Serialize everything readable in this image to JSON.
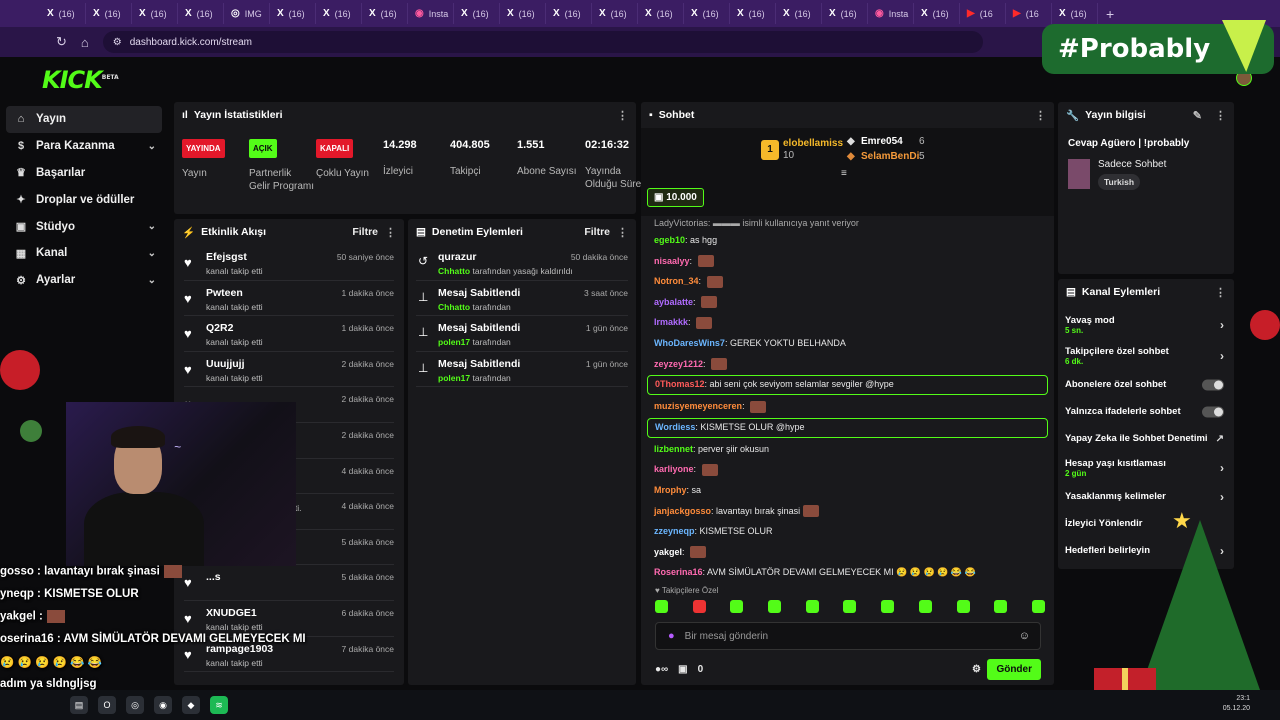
{
  "browser": {
    "tabs": [
      {
        "icon": "X",
        "label": "(16)"
      },
      {
        "icon": "X",
        "label": "(16)"
      },
      {
        "icon": "X",
        "label": "(16)"
      },
      {
        "icon": "X",
        "label": "(16)"
      },
      {
        "icon": "◎",
        "label": "IMG"
      },
      {
        "icon": "X",
        "label": "(16)"
      },
      {
        "icon": "X",
        "label": "(16)"
      },
      {
        "icon": "X",
        "label": "(16)"
      },
      {
        "icon": "◉",
        "label": "Insta"
      },
      {
        "icon": "X",
        "label": "(16)"
      },
      {
        "icon": "X",
        "label": "(16)"
      },
      {
        "icon": "X",
        "label": "(16)"
      },
      {
        "icon": "X",
        "label": "(16)"
      },
      {
        "icon": "X",
        "label": "(16)"
      },
      {
        "icon": "X",
        "label": "(16)"
      },
      {
        "icon": "X",
        "label": "(16)"
      },
      {
        "icon": "X",
        "label": "(16)"
      },
      {
        "icon": "X",
        "label": "(16)"
      },
      {
        "icon": "◉",
        "label": "Insta"
      },
      {
        "icon": "X",
        "label": "(16)"
      },
      {
        "icon": "▶",
        "label": "(16"
      },
      {
        "icon": "▶",
        "label": "(16"
      },
      {
        "icon": "X",
        "label": "(16)"
      }
    ],
    "new_tab": "+",
    "url": "dashboard.kick.com/stream"
  },
  "brand": {
    "logo": "KICK",
    "beta": "BETA",
    "accent": "#53fc18"
  },
  "overlay_banner": "#Probably",
  "sidebar": {
    "items": [
      {
        "icon": "home-icon",
        "label": "Yayın",
        "chevron": false
      },
      {
        "icon": "money-icon",
        "label": "Para Kazanma",
        "chevron": true
      },
      {
        "icon": "trophy-icon",
        "label": "Başarılar",
        "chevron": false
      },
      {
        "icon": "reward-icon",
        "label": "Droplar ve ödüller",
        "chevron": false
      },
      {
        "icon": "studio-icon",
        "label": "Stüdyo",
        "chevron": true
      },
      {
        "icon": "channel-icon",
        "label": "Kanal",
        "chevron": true
      },
      {
        "icon": "settings-icon",
        "label": "Ayarlar",
        "chevron": true
      }
    ]
  },
  "stats": {
    "title": "Yayın İstatistikleri",
    "items": [
      {
        "badge": "YAYINDA",
        "label": "Yayın"
      },
      {
        "badge": "AÇIK",
        "label": "Partnerlik Gelir Programı"
      },
      {
        "badge": "KAPALI",
        "label": "Çoklu Yayın"
      },
      {
        "value": "14.298",
        "label": "İzleyici"
      },
      {
        "value": "404.805",
        "label": "Takipçi"
      },
      {
        "value": "1.551",
        "label": "Abone Sayısı"
      },
      {
        "value": "02:16:32",
        "label": "Yayında Olduğu Süre"
      }
    ]
  },
  "activity": {
    "title": "Etkinlik Akışı",
    "filter": "Filtre",
    "rows": [
      {
        "name": "Efejsgst",
        "sub": "kanalı takip etti",
        "time": "50 saniye önce"
      },
      {
        "name": "Pwteen",
        "sub": "kanalı takip etti",
        "time": "1 dakika önce"
      },
      {
        "name": "Q2R2",
        "sub": "kanalı takip etti",
        "time": "1 dakika önce"
      },
      {
        "name": "Uuujjujj",
        "sub": "kanalı takip etti",
        "time": "2 dakika önce"
      },
      {
        "name": "",
        "sub": "",
        "time": "2 dakika önce"
      },
      {
        "name": "",
        "sub": "",
        "time": "2 dakika önce"
      },
      {
        "name": "",
        "sub": "",
        "time": "4 dakika önce"
      },
      {
        "name": "",
        "sub": "ıcıya abonelik hediye etti.",
        "time": "4 dakika önce"
      },
      {
        "name": "",
        "sub": "",
        "time": "5 dakika önce"
      },
      {
        "name": "...s",
        "sub": "",
        "time": "5 dakika önce"
      },
      {
        "name": "XNUDGE1",
        "sub": "kanalı takip etti",
        "time": "6 dakika önce"
      },
      {
        "name": "rampage1903",
        "sub": "kanalı takip etti",
        "time": "7 dakika önce"
      }
    ]
  },
  "moderation": {
    "title": "Denetim Eylemleri",
    "filter": "Filtre",
    "rows": [
      {
        "icon": "undo-icon",
        "name": "qurazur",
        "actor": "Chhatto",
        "sub": "tarafından yasağı kaldırıldı",
        "time": "50 dakika önce"
      },
      {
        "icon": "pin-icon",
        "name": "Mesaj Sabitlendi",
        "actor": "Chhatto",
        "sub": "tarafından",
        "time": "3 saat önce"
      },
      {
        "icon": "pin-icon",
        "name": "Mesaj Sabitlendi",
        "actor": "polen17",
        "sub": "tarafından",
        "time": "1 gün önce"
      },
      {
        "icon": "pin-icon",
        "name": "Mesaj Sabitlendi",
        "actor": "polen17",
        "sub": "tarafından",
        "time": "1 gün önce"
      }
    ]
  },
  "chat": {
    "title": "Sohbet",
    "leaders": [
      {
        "rank": "1",
        "name": "elobellamiss",
        "count": "10"
      },
      {
        "rank": "2",
        "name": "Emre054",
        "count": "6"
      },
      {
        "rank": "3",
        "name": "SelamBenDi",
        "count": "5"
      }
    ],
    "gift_total": "10.000",
    "reply_hint": "LadyVictorias:",
    "reply_suffix": "isimli kullanıcıya yanıt veriyor",
    "messages": [
      {
        "user": "egeb10",
        "color": "#53fc18",
        "text": "as hgg",
        "emote": false,
        "hl": false
      },
      {
        "user": "nisaalyy",
        "color": "#ff6ab0",
        "text": "",
        "emote": true,
        "hl": false
      },
      {
        "user": "Notron_34",
        "color": "#ff8c3b",
        "text": "",
        "emote": true,
        "hl": false
      },
      {
        "user": "aybalatte",
        "color": "#b06bff",
        "text": "",
        "emote": true,
        "hl": false
      },
      {
        "user": "Irmakkk",
        "color": "#b06bff",
        "text": "",
        "emote": true,
        "hl": false
      },
      {
        "user": "WhoDaresWins7",
        "color": "#6bb6ff",
        "text": "GEREK YOKTU BELHANDA",
        "emote": false,
        "hl": false
      },
      {
        "user": "zeyzey1212",
        "color": "#ff6ab0",
        "text": "",
        "emote": true,
        "hl": false
      },
      {
        "user": "0Thomas12",
        "color": "#ff5a5a",
        "text": "abi seni çok seviyom selamlar sevgiler @hype",
        "emote": false,
        "hl": true
      },
      {
        "user": "muzisyemeyenceren",
        "color": "#ff8c3b",
        "text": "",
        "emote": true,
        "hl": false
      },
      {
        "user": "Wordiess",
        "color": "#6bb6ff",
        "text": "KISMETSE OLUR @hype",
        "emote": false,
        "hl": true
      },
      {
        "user": "lizbennet",
        "color": "#53fc18",
        "text": "perver şiir okusun",
        "emote": false,
        "hl": false
      },
      {
        "user": "karliyone",
        "color": "#ff6ab0",
        "text": "",
        "emote": true,
        "hl": false
      },
      {
        "user": "Mrophy",
        "color": "#ff8c3b",
        "text": "sa",
        "emote": false,
        "hl": false
      },
      {
        "user": "janjackgosso",
        "color": "#ff8c3b",
        "text": "lavantayı bırak şinasi",
        "emote": true,
        "hl": false
      },
      {
        "user": "zzeyneqp",
        "color": "#6bb6ff",
        "text": "KISMETSE OLUR",
        "emote": false,
        "hl": false
      },
      {
        "user": "yakgel",
        "color": "#fff",
        "text": "",
        "emote": true,
        "hl": false
      },
      {
        "user": "Roserina16",
        "color": "#ff6ab0",
        "text": "AVM SİMÜLATÖR DEVAMI GELMEYECEK MI 😢 😢 😢 😢 😂 😂",
        "emote": false,
        "hl": false
      }
    ],
    "sub_only": "Takipçilere Özel",
    "placeholder": "Bir mesaj gönderin",
    "footer_count": "0",
    "send": "Gönder"
  },
  "stream_info": {
    "title": "Yayın bilgisi",
    "stream_title": "Cevap Agüero | !probably",
    "category": "Sadece Sohbet",
    "tag": "Turkish"
  },
  "channel_actions": {
    "title": "Kanal Eylemleri",
    "rows": [
      {
        "label": "Yavaş mod",
        "sub": "5 sn.",
        "type": "chevron"
      },
      {
        "label": "Takipçilere özel sohbet",
        "sub": "6 dk.",
        "type": "chevron"
      },
      {
        "label": "Abonelere özel sohbet",
        "sub": "",
        "type": "toggle"
      },
      {
        "label": "Yalnızca ifadelerle sohbet",
        "sub": "",
        "type": "toggle"
      },
      {
        "label": "Yapay Zeka ile Sohbet Denetimi",
        "sub": "",
        "type": "link"
      },
      {
        "label": "Hesap yaşı kısıtlaması",
        "sub": "2 gün",
        "type": "chevron"
      },
      {
        "label": "Yasaklanmış kelimeler",
        "sub": "",
        "type": "chevron"
      },
      {
        "label": "İzleyici Yönlendir",
        "sub": "",
        "type": "none"
      },
      {
        "label": "Hedefleri belirleyin",
        "sub": "",
        "type": "chevron"
      }
    ]
  },
  "stream_overlay": {
    "lines": [
      {
        "text": "gosso : lavantayı bırak şinasi",
        "emote": true
      },
      {
        "text": "yneqp : KISMETSE OLUR",
        "emote": false
      },
      {
        "text": "yakgel :",
        "emote": true
      },
      {
        "text": "oserina16 : AVM SİMÜLATÖR DEVAMI GELMEYECEK MI",
        "emote": false
      },
      {
        "text": "😢 😢 😢 😢 😂 😂",
        "emote": false
      },
      {
        "text": "adım ya sldngljsg",
        "emote": false
      }
    ]
  },
  "taskbar": {
    "clock_time": "23:1",
    "clock_date": "05.12.20"
  }
}
